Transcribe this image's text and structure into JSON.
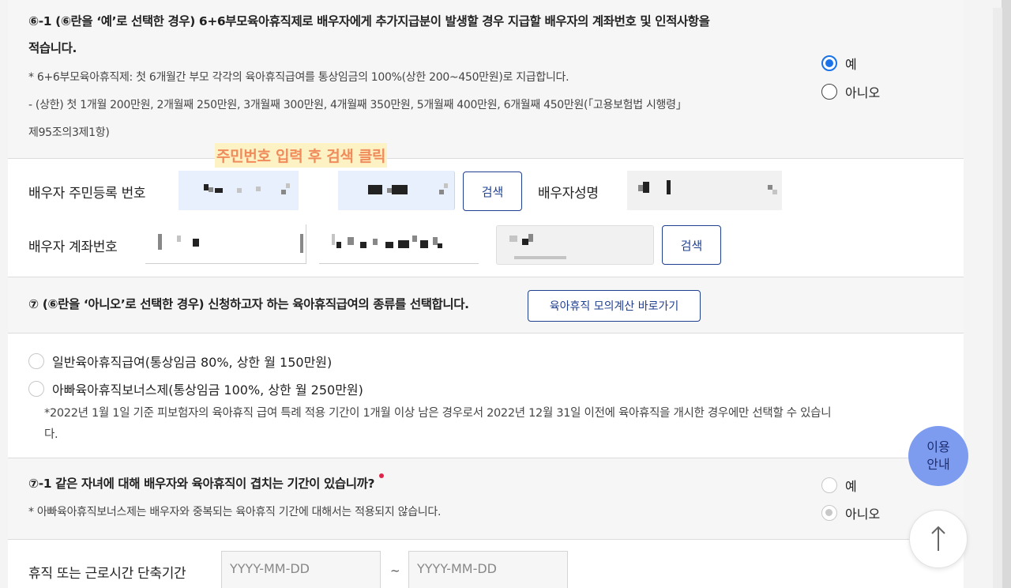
{
  "q6_1": {
    "title_line1": "⑥-1 (⑥란을 ‘예’로 선택한 경우) 6+6부모육아휴직제로 배우자에게 추가지급분이 발생할 경우 지급할 배우자의 계좌번호 및 인적사항을",
    "title_line2": "적습니다.",
    "note1": "* 6+6부모육아휴직제: 첫 6개월간 부모 각각의 육아휴직급여를 통상임금의 100%(상한 200~450만원)로 지급합니다.",
    "note2": "- (상한) 첫 1개월 200만원, 2개월째 250만원, 3개월째 300만원, 4개월째 350만원, 5개월째 400만원, 6개월째 450만원(「고용보험법 시행령」",
    "note3": "제95조의3제1항)",
    "options": [
      "예",
      "아니오"
    ],
    "selected": "예"
  },
  "annotation": "주민번호 입력 후 검색 클릭",
  "spouse": {
    "rrn_label": "배우자 주민등록 번호",
    "search_label": "검색",
    "name_label": "배우자성명",
    "account_label": "배우자 계좌번호",
    "account_search_label": "검색"
  },
  "q7": {
    "title": "⑦ (⑥란을 ‘아니오’로 선택한 경우) 신청하고자 하는 육아휴직급여의 종류를 선택합니다.",
    "calc_button": "육아휴직 모의계산 바로가기",
    "option1": "일반육아휴직급여(통상임금 80%, 상한 월 150만원)",
    "option2": "아빠육아휴직보너스제(통상임금 100%, 상한 월 250만원)",
    "note_line1": "*2022년 1월 1일 기준 피보험자의 육아휴직 급여 특례 적용 기간이 1개월 이상 남은 경우로서 2022년 12월 31일 이전에 육아휴직을 개시한 경우에만 선택할 수 있습니",
    "note_line2": "다."
  },
  "q7_1": {
    "title": "⑦-1 같은 자녀에 대해 배우자와 육아휴직이 겹치는 기간이 있습니까?",
    "note": "* 아빠육아휴직보너스제는 배우자와 중복되는 육아휴직 기간에 대해서는 적용되지 않습니다.",
    "options": [
      "예",
      "아니오"
    ],
    "selected": "아니오"
  },
  "period": {
    "label": "휴직 또는 근로시간 단축기간",
    "start_placeholder": "YYYY-MM-DD",
    "separator": "~",
    "end_placeholder": "YYYY-MM-DD"
  },
  "help": {
    "line1": "이용",
    "line2": "안내"
  },
  "colors": {
    "accent": "#1a73e8",
    "button_border": "#1f3f8f",
    "help_bg": "#7d9cf0",
    "annotation_text": "#f08b5c",
    "annotation_bg": "#fdf2c4"
  },
  "icons": {
    "scroll_top": "arrow-up-icon"
  }
}
